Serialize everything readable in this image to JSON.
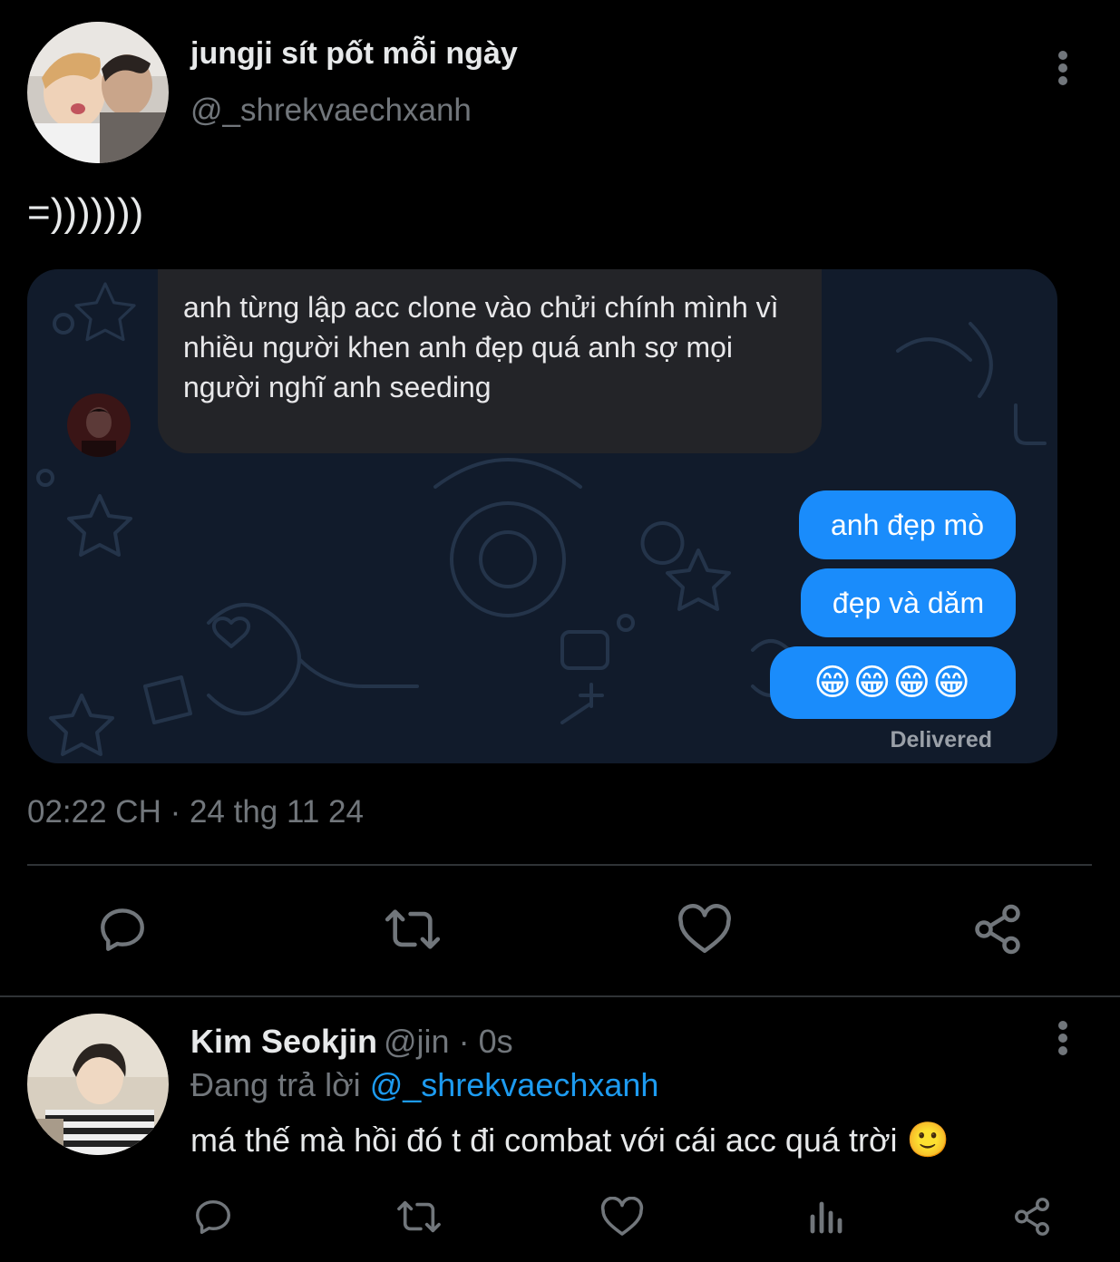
{
  "main_tweet": {
    "display_name": "jungji sít pốt mỗi ngày",
    "handle": "@_shrekvaechxanh",
    "text": "=)))))))",
    "chat": {
      "incoming_message": "anh từng lập acc clone vào chửi chính mình vì nhiều người khen anh đẹp quá anh sợ mọi người nghĩ anh seeding",
      "outgoing_messages": [
        "anh đẹp mò",
        "đẹp và dăm",
        "😁😁😁😁"
      ],
      "status": "Delivered"
    },
    "timestamp": "02:22 CH · 24 thg 11 24",
    "actions": [
      "reply",
      "retweet",
      "like",
      "share"
    ]
  },
  "reply_tweet": {
    "display_name": "Kim Seokjin",
    "handle": "@jin",
    "separator": "·",
    "time": "0s",
    "replying_prefix": "Đang trả lời",
    "replying_to": "@_shrekvaechxanh",
    "text": "má thế mà hồi đó t đi combat với cái acc quá trời",
    "emoji": "🙂",
    "actions": [
      "reply",
      "retweet",
      "like",
      "views",
      "share"
    ]
  },
  "colors": {
    "background": "#000000",
    "accent": "#1d9bf0",
    "secondary_text": "#71767b",
    "outgoing_bubble": "#1a8cfb",
    "incoming_bubble": "#232428",
    "chat_background": "#111b2b"
  }
}
